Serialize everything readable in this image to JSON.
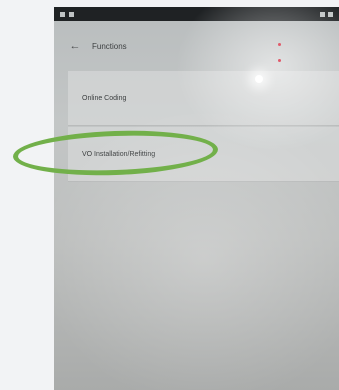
{
  "toolbar": {
    "title": "Functions"
  },
  "list": {
    "items": [
      {
        "label": "Online Coding"
      },
      {
        "label": "VO Installation/Refitting"
      }
    ]
  },
  "colors": {
    "annotation_ellipse": "#72b04a",
    "background": "#f2f3f5"
  },
  "icons": {
    "back": "arrow-left-icon"
  }
}
